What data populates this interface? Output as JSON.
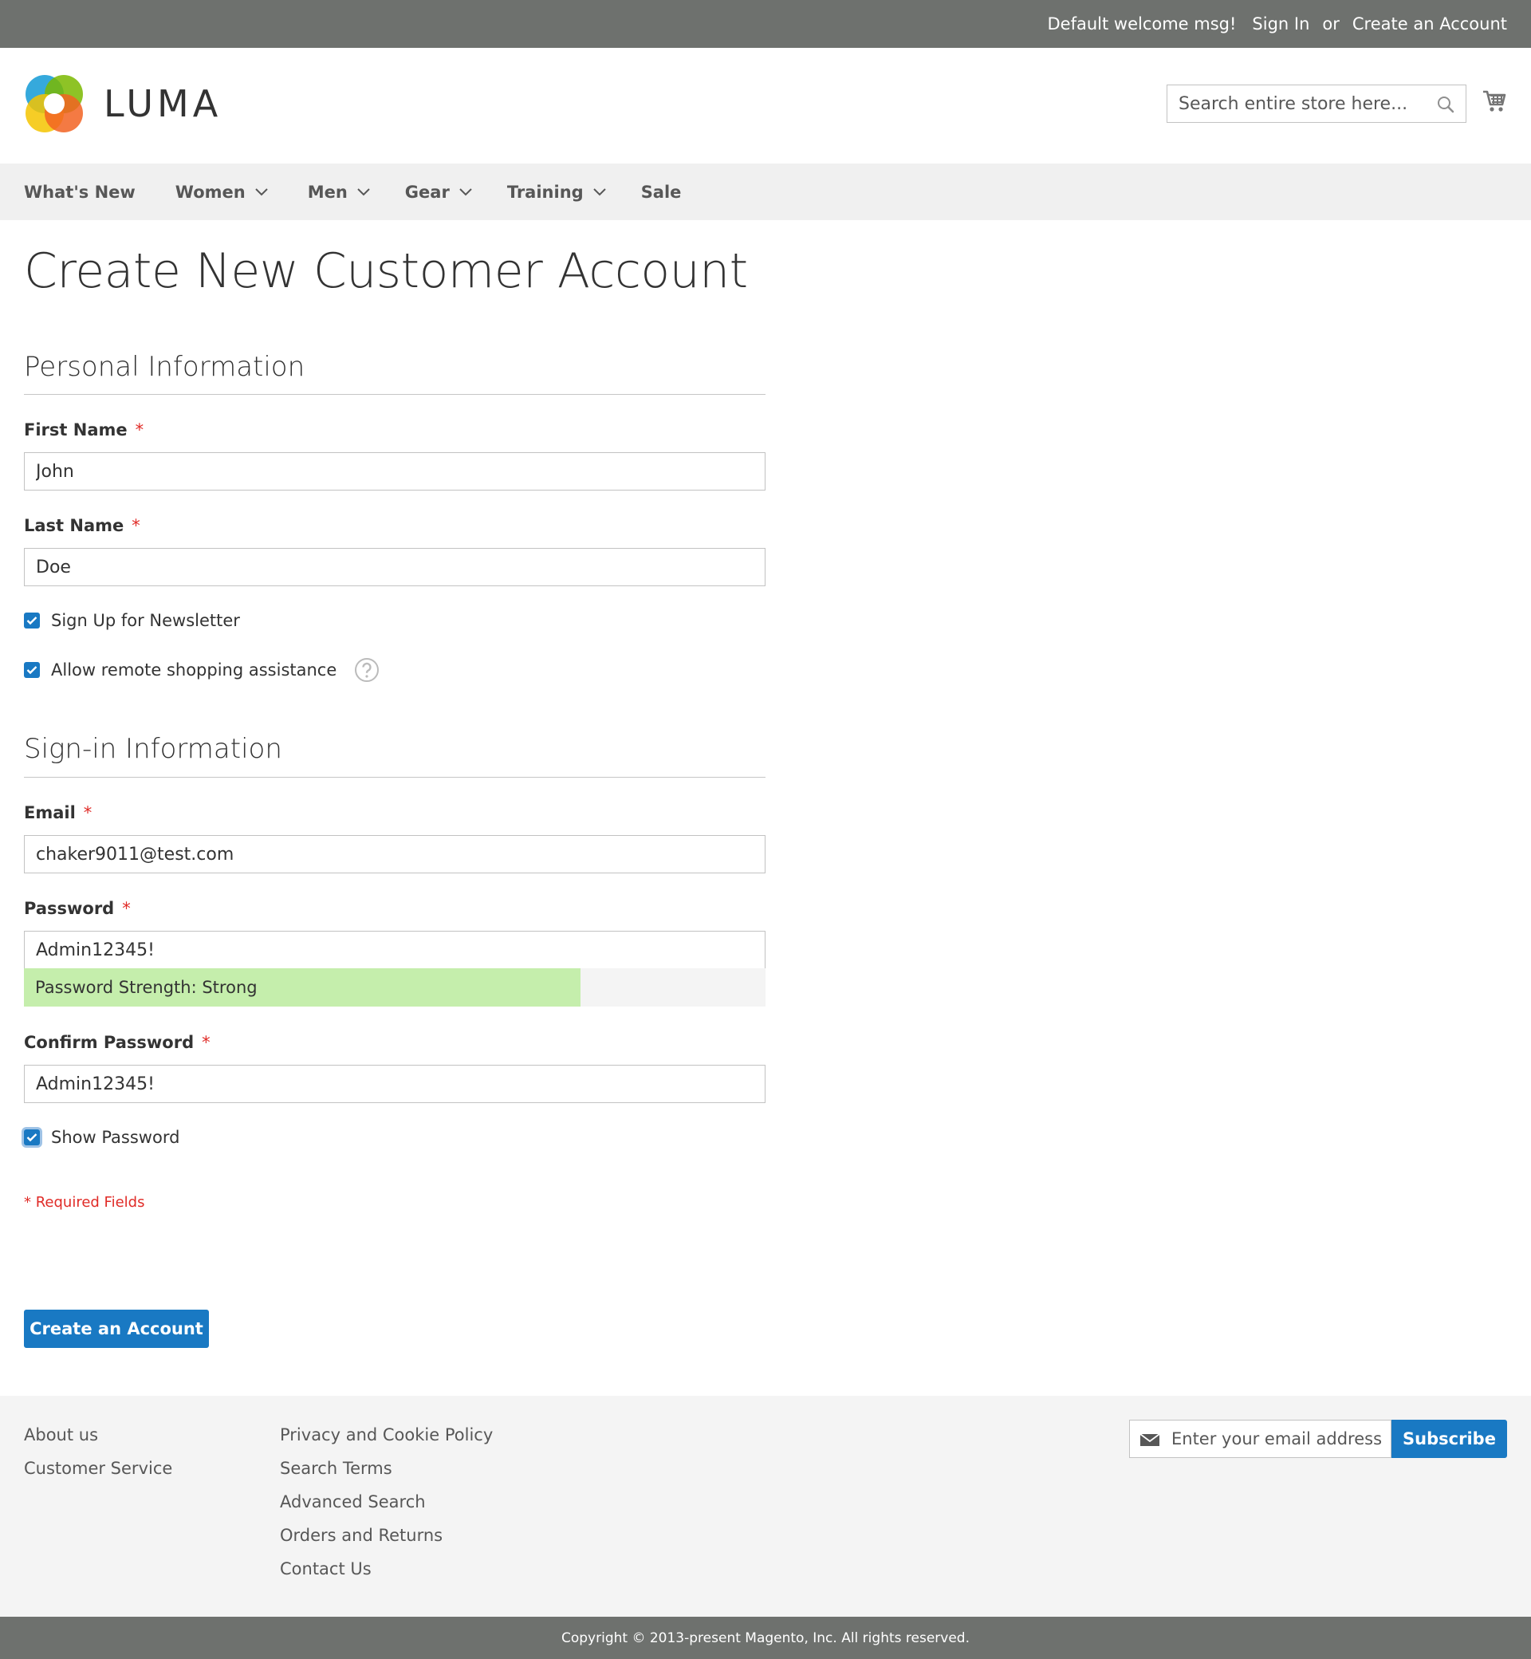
{
  "topbar": {
    "welcome": "Default welcome msg!",
    "sign_in": "Sign In",
    "or": "or",
    "create_account": "Create an Account"
  },
  "header": {
    "logo_text": "LUMA",
    "search_placeholder": "Search entire store here...",
    "cart_icon": "cart-icon",
    "search_icon": "search-icon"
  },
  "nav": {
    "items": [
      {
        "label": "What's New",
        "has_dropdown": false
      },
      {
        "label": "Women",
        "has_dropdown": true
      },
      {
        "label": "Men",
        "has_dropdown": true
      },
      {
        "label": "Gear",
        "has_dropdown": true
      },
      {
        "label": "Training",
        "has_dropdown": true
      },
      {
        "label": "Sale",
        "has_dropdown": false
      }
    ]
  },
  "page": {
    "title": "Create New Customer Account"
  },
  "personal": {
    "heading": "Personal Information",
    "first_name_label": "First Name",
    "first_name_value": "John",
    "last_name_label": "Last Name",
    "last_name_value": "Doe",
    "newsletter_label": "Sign Up for Newsletter",
    "newsletter_checked": true,
    "assistance_label": "Allow remote shopping assistance",
    "assistance_checked": true,
    "required_mark": "*"
  },
  "signin": {
    "heading": "Sign-in Information",
    "email_label": "Email",
    "email_value": "chaker9011@test.com",
    "password_label": "Password",
    "password_value": "Admin12345!",
    "strength_text": "Password Strength: Strong",
    "strength_level": 0.75,
    "confirm_label": "Confirm Password",
    "confirm_value": "Admin12345!",
    "show_password_label": "Show Password",
    "show_password_checked": true,
    "required_mark": "*"
  },
  "form": {
    "required_note": "* Required Fields",
    "submit_label": "Create an Account"
  },
  "footer": {
    "col1": [
      "About us",
      "Customer Service"
    ],
    "col2": [
      "Privacy and Cookie Policy",
      "Search Terms",
      "Advanced Search",
      "Orders and Returns",
      "Contact Us"
    ],
    "newsletter_placeholder": "Enter your email address",
    "subscribe_label": "Subscribe",
    "copyright": "Copyright © 2013-present Magento, Inc. All rights reserved."
  },
  "colors": {
    "accent": "#1979c3",
    "topbar": "#6e716e",
    "required": "#e02b27",
    "strength": "#c5eeac"
  }
}
